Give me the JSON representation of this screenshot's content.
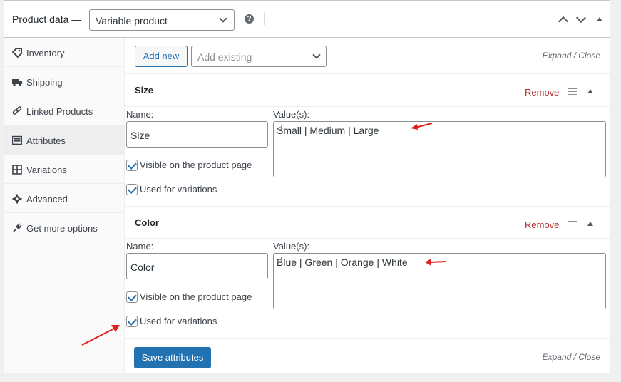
{
  "header": {
    "title": "Product data —",
    "product_type": "Variable product",
    "help_icon": "help-icon",
    "toggle_icons": [
      "chevron-up-icon",
      "chevron-down-icon",
      "collapse-triangle-icon"
    ]
  },
  "sidebar": {
    "items": [
      {
        "label": "Inventory",
        "icon": "tag-icon"
      },
      {
        "label": "Shipping",
        "icon": "truck-icon"
      },
      {
        "label": "Linked Products",
        "icon": "link-icon"
      },
      {
        "label": "Attributes",
        "icon": "list-icon"
      },
      {
        "label": "Variations",
        "icon": "grid-icon"
      },
      {
        "label": "Advanced",
        "icon": "gear-icon"
      },
      {
        "label": "Get more options",
        "icon": "plugin-icon"
      }
    ],
    "active": "Attributes"
  },
  "toolbar": {
    "add_new_label": "Add new",
    "add_existing_placeholder": "Add existing",
    "expand_close": "Expand / Close"
  },
  "attributes": [
    {
      "title": "Size",
      "remove_label": "Remove",
      "name_label": "Name:",
      "name_value": "Size",
      "values_label": "Value(s):",
      "values_value": "Small | Medium | Large",
      "visible_label": "Visible on the product page",
      "visible_checked": true,
      "variations_label": "Used for variations",
      "variations_checked": true
    },
    {
      "title": "Color",
      "remove_label": "Remove",
      "name_label": "Name:",
      "name_value": "Color",
      "values_label": "Value(s):",
      "values_value": "Blue | Green | Orange | White",
      "visible_label": "Visible on the product page",
      "visible_checked": true,
      "variations_label": "Used for variations",
      "variations_checked": true
    }
  ],
  "footer": {
    "save_label": "Save attributes",
    "expand_close": "Expand / Close"
  },
  "colors": {
    "accent": "#2271b1",
    "remove": "#b32d2e",
    "annotation_arrow": "#e0201b"
  }
}
